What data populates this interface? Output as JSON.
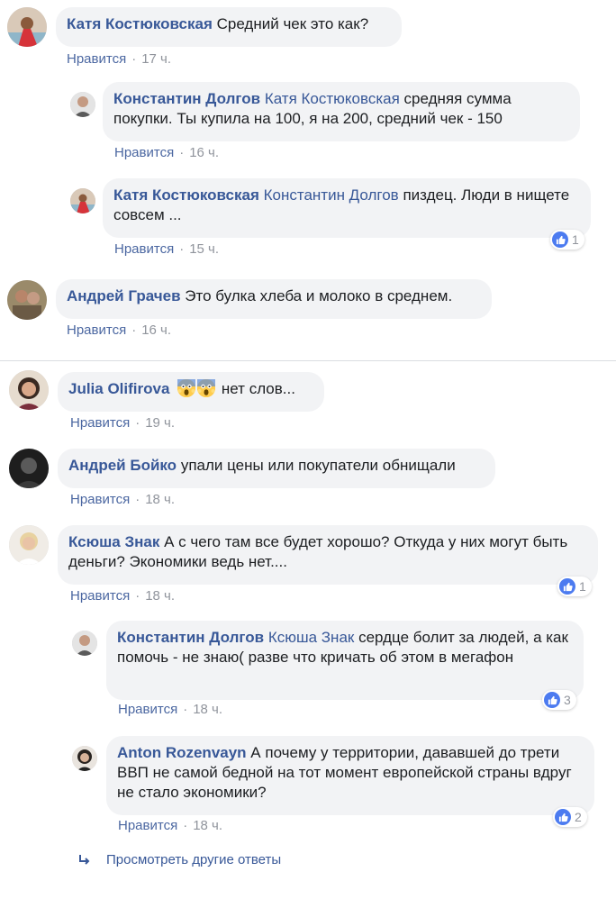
{
  "like_label": "Нравится",
  "like_color": "#385898",
  "author_color": "#385898",
  "bubble_bg": "#f2f3f5",
  "reaction_icon": "thumbs-up-icon",
  "comments": [
    {
      "author": "Катя Костюковская",
      "text": "Средний чек это как?",
      "time": "17 ч.",
      "replies": [
        {
          "author": "Константин Долгов",
          "mention": "Катя Костюковская",
          "text": "средняя сумма покупки. Ты купила на 100, я на 200, средний чек - 150",
          "time": "16 ч."
        },
        {
          "author": "Катя Костюковская",
          "mention": "Константин Долгов",
          "text": "пиздец. Люди в нищете совсем ...",
          "time": "15 ч.",
          "reactions": "1"
        }
      ]
    },
    {
      "author": "Андрей Грачев",
      "text": "Это булка хлеба и молоко в среднем.",
      "time": "16 ч."
    },
    {
      "author": "Julia Olifirova",
      "emoji": [
        "screaming-face-emoji",
        "screaming-face-emoji"
      ],
      "text": "нет слов...",
      "time": "19 ч."
    },
    {
      "author": "Андрей Бойко",
      "text": "упали цены или покупатели обнищали",
      "time": "18 ч."
    },
    {
      "author": "Ксюша Знак",
      "text": "А с чего там все будет хорошо? Откуда у них могут быть деньги? Экономики ведь нет....",
      "time": "18 ч.",
      "reactions": "1",
      "replies": [
        {
          "author": "Константин Долгов",
          "mention": "Ксюша Знак",
          "text": "сердце болит за людей, а как помочь - не знаю( разве что кричать об этом в мегафон",
          "time": "18 ч.",
          "reactions": "3"
        },
        {
          "author": "Anton Rozenvayn",
          "text": "А почему у территории, дававшей до трети ВВП не самой бедной на тот момент европейской страны вдруг не стало экономики?",
          "time": "18 ч.",
          "reactions": "2"
        }
      ]
    }
  ],
  "more_replies": "Просмотреть другие ответы"
}
